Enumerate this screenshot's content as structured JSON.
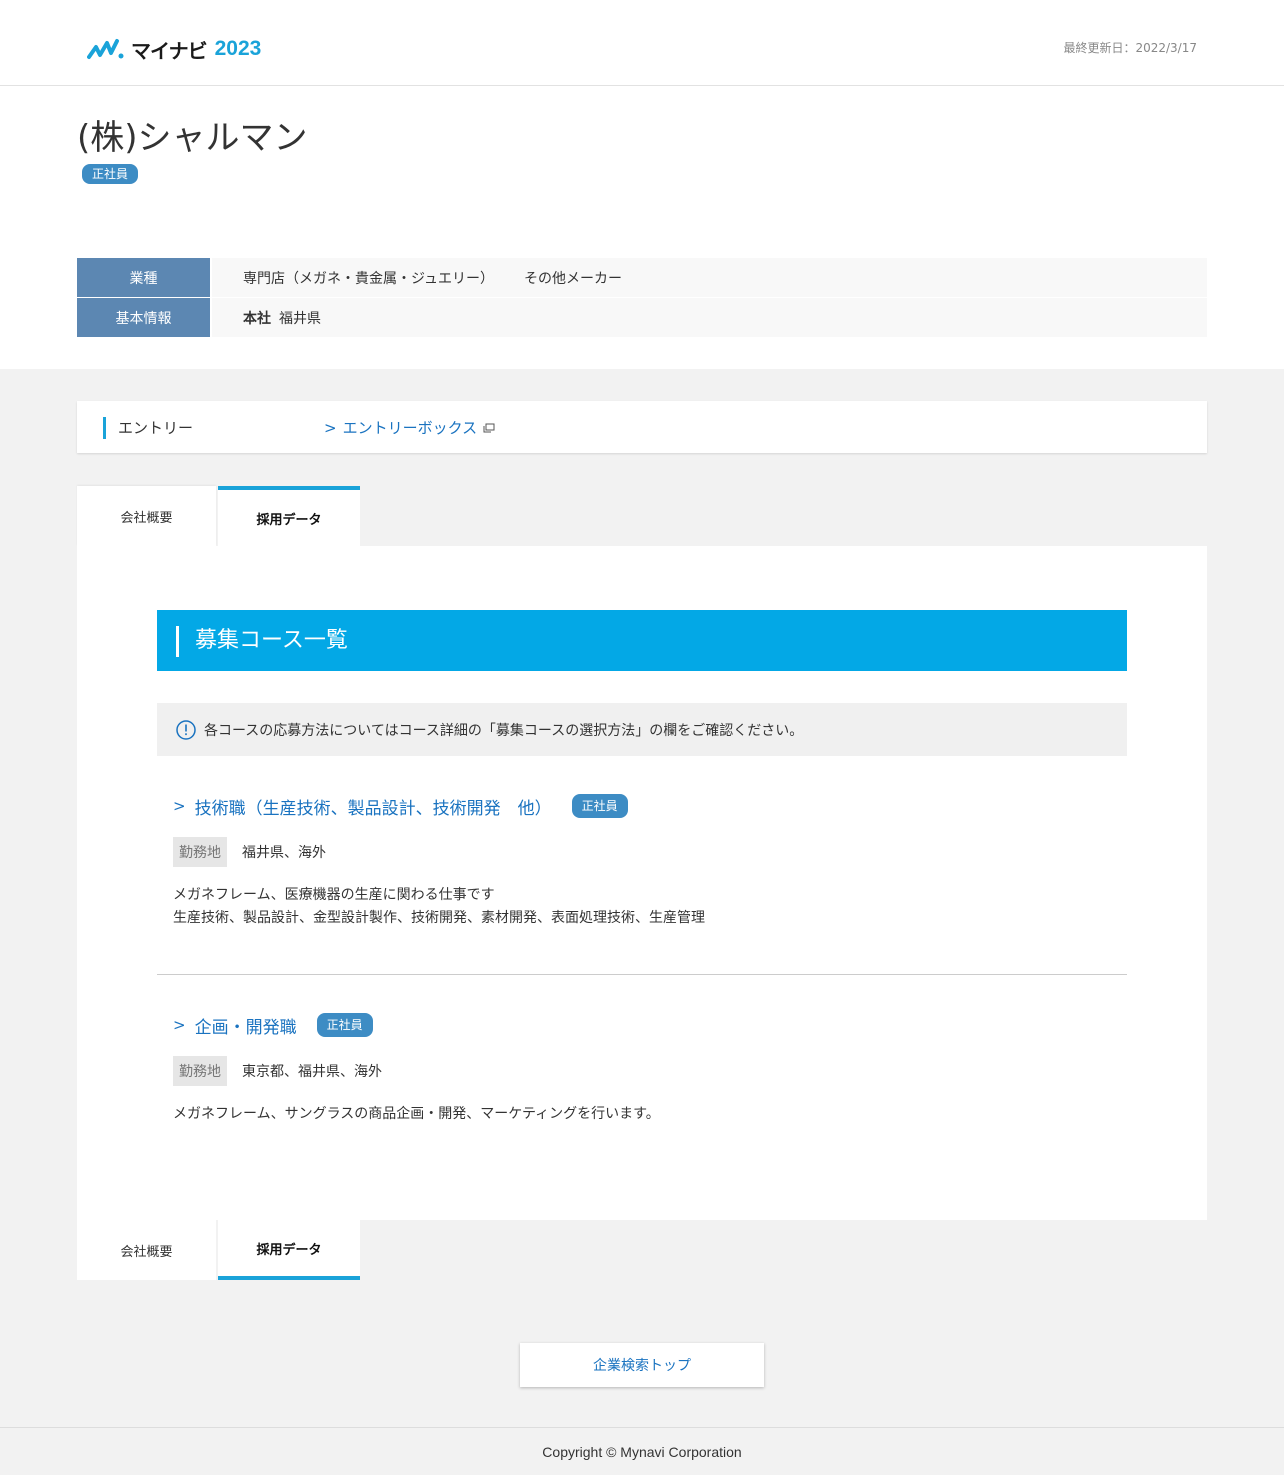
{
  "header": {
    "logo": {
      "kana": "マイナビ",
      "year": "2023"
    },
    "updated": "最終更新日：2022/3/17"
  },
  "company": {
    "name": "(株)シャルマン",
    "badge": "正社員",
    "info": [
      {
        "label": "業種",
        "values": [
          "専門店（メガネ・貴金属・ジュエリー）",
          "その他メーカー"
        ]
      },
      {
        "label": "基本情報",
        "key": "本社",
        "value": "福井県"
      }
    ]
  },
  "entry": {
    "label": "エントリー",
    "link": "エントリーボックス"
  },
  "tabs": {
    "overview": "会社概要",
    "recruit": "採用データ"
  },
  "courses_section": {
    "title": "募集コース一覧",
    "notice": "各コースの応募方法についてはコース詳細の「募集コースの選択方法」の欄をご確認ください。",
    "courses": [
      {
        "title": "技術職（生産技術、製品設計、技術開発　他）",
        "badge": "正社員",
        "loc_label": "勤務地",
        "loc": "福井県、海外",
        "desc": [
          "メガネフレーム、医療機器の生産に関わる仕事です",
          "生産技術、製品設計、金型設計製作、技術開発、素材開発、表面処理技術、生産管理"
        ]
      },
      {
        "title": "企画・開発職",
        "badge": "正社員",
        "loc_label": "勤務地",
        "loc": "東京都、福井県、海外",
        "desc": [
          "メガネフレーム、サングラスの商品企画・開発、マーケティングを行います。"
        ]
      }
    ]
  },
  "top_button": "企業検索トップ",
  "footer": "Copyright © Mynavi Corporation",
  "colors": {
    "accent": "#03a8e6",
    "link": "#1a73c0",
    "badge": "#3d8cc4",
    "th": "#5c87b2"
  }
}
